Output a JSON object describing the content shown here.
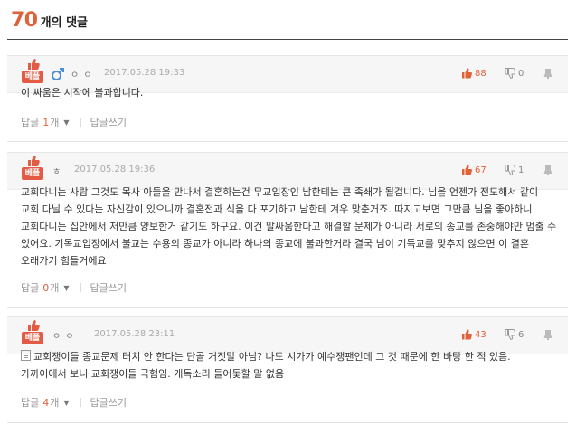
{
  "header": {
    "count": "70",
    "label": "개의 댓글"
  },
  "best_label": "베플",
  "comments": [
    {
      "nick": "ㅇ ㅇ",
      "date": "2017.05.28 19:33",
      "likes": "88",
      "dislikes": "0",
      "text": "이 싸움은 시작에 불과합니다.",
      "reply_label": "답글",
      "reply_count": "1",
      "reply_suffix": "개",
      "write_label": "답글쓰기"
    },
    {
      "nick": "ㅎ",
      "date": "2017.05.28 19:36",
      "likes": "67",
      "dislikes": "1",
      "text": "교회다니는 사람 그것도 목사 아들을 만나서 결혼하는건 무교입장인 남한테는 큰 족쇄가 될겁니다. 님을 언젠가 전도해서 같이 교회 다닐 수 있다는 자신감이 있으니까 결혼전과 식을 다 포기하고 남한테 겨우 맞춘거죠. 따지고보면 그만큼 님을 좋아하니 교회다니는 집안에서 저만큼 양보한거 같기도 하구요. 이건 말싸움한다고 해결할 문제가 아니라 서로의 종교를 존중해야만 멈출 수 있어요. 기독교입장에서 불교는 수용의 종교가 아니라 하나의 종교에 불과한거라 결국 님이 기독교를 맞추지 않으면 이 결혼 오래가기 힘들거에요",
      "reply_label": "답글",
      "reply_count": "0",
      "reply_suffix": "개",
      "write_label": "답글쓰기"
    },
    {
      "nick": "ㅇ ㅇ",
      "date": "2017.05.28 23:11",
      "likes": "43",
      "dislikes": "6",
      "text": "교회쟁이들 종교문제 터치 안 한다는 단골 거짓말 아님? 나도 시가가 예수쟁팬인데 그 것 때문에 한 바탕 한 적 있음. 가까이에서 보니 교회쟁이들 극혐임. 개독소리 들어돛할 말 없음",
      "reply_label": "답글",
      "reply_count": "4",
      "reply_suffix": "개",
      "write_label": "답글쓰기"
    }
  ],
  "colors": {
    "accent": "#e0623b",
    "best_badge": "#e35b44",
    "gender_male": "#4a8fd6"
  },
  "icons": [
    "thumbs-up-icon",
    "male-icon",
    "like-icon",
    "dislike-icon",
    "report-icon",
    "document-icon",
    "caret-down-icon"
  ]
}
